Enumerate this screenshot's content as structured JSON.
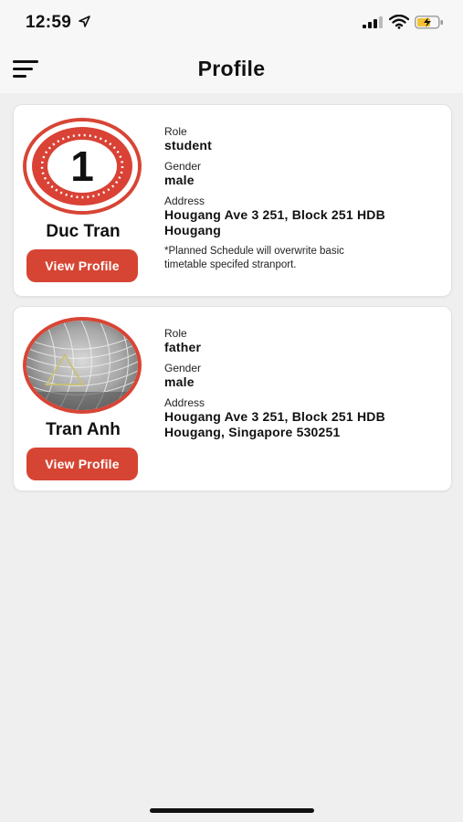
{
  "status": {
    "time": "12:59"
  },
  "header": {
    "title": "Profile"
  },
  "profiles": [
    {
      "name": "Duc Tran",
      "avatar_number": "1",
      "button": "View Profile",
      "role_label": "Role",
      "role": "student",
      "gender_label": "Gender",
      "gender": "male",
      "address_label": "Address",
      "address_line1": "Hougang Ave 3 251, Block 251 HDB",
      "address_line2": "Hougang",
      "note_line1": "*Planned Schedule will overwrite basic",
      "note_line2": "timetable specifed stranport."
    },
    {
      "name": "Tran Anh",
      "button": "View Profile",
      "role_label": "Role",
      "role": "father",
      "gender_label": "Gender",
      "gender": "male",
      "address_label": "Address",
      "address_line1": "Hougang Ave 3 251, Block 251 HDB",
      "address_line2": "Hougang, Singapore 530251"
    }
  ],
  "colors": {
    "accent": "#d64533",
    "background": "#efefef",
    "card": "#ffffff"
  },
  "icons": [
    "location-arrow-icon",
    "signal-icon",
    "wifi-icon",
    "battery-charging-icon",
    "menu-icon"
  ]
}
